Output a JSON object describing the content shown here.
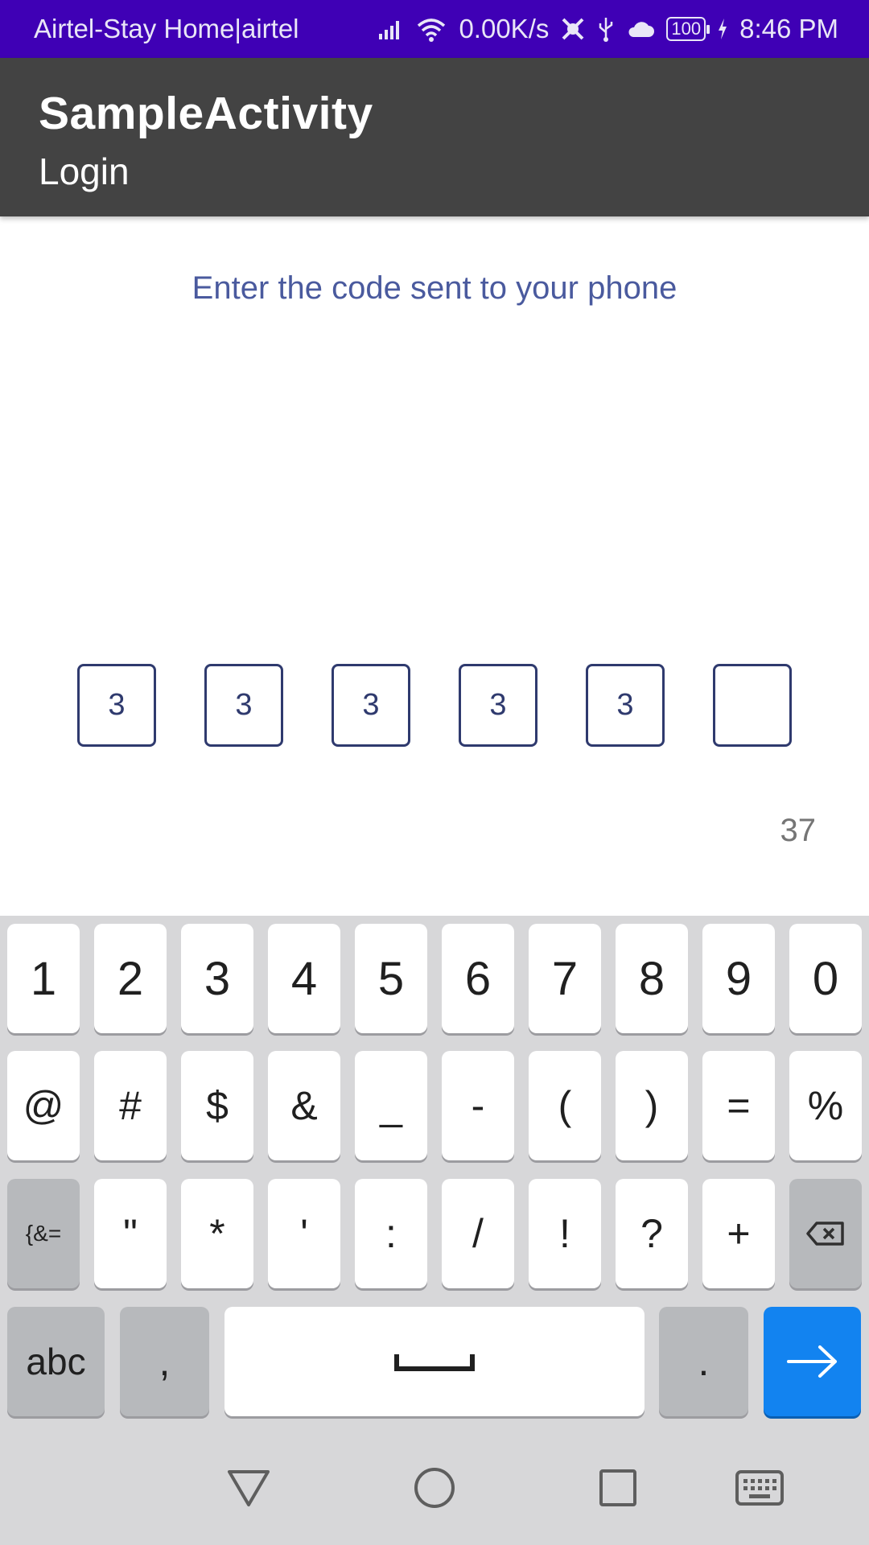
{
  "status_bar": {
    "carrier": "Airtel-Stay Home|airtel",
    "net_speed": "0.00K/s",
    "battery": "100",
    "time": "8:46 PM"
  },
  "app_bar": {
    "title": "SampleActivity",
    "subtitle": "Login"
  },
  "content": {
    "prompt": "Enter the code sent to your phone",
    "otp_digits": [
      "3",
      "3",
      "3",
      "3",
      "3",
      ""
    ],
    "timer": "37"
  },
  "keyboard": {
    "row1": [
      "1",
      "2",
      "3",
      "4",
      "5",
      "6",
      "7",
      "8",
      "9",
      "0"
    ],
    "row2": [
      "@",
      "#",
      "$",
      "&",
      "_",
      "-",
      "(",
      ")",
      "=",
      "%"
    ],
    "row3": [
      "{&=",
      "\"",
      "*",
      "'",
      ":",
      "/",
      "!",
      "?",
      "+"
    ],
    "row4": {
      "abc": "abc",
      "comma": ",",
      "period": "."
    }
  },
  "colors": {
    "status_bar": "#3f00b5",
    "app_bar": "#434343",
    "accent": "#1283f0",
    "otp_border": "#2f3a6e",
    "prompt_text": "#4a5a9e"
  }
}
